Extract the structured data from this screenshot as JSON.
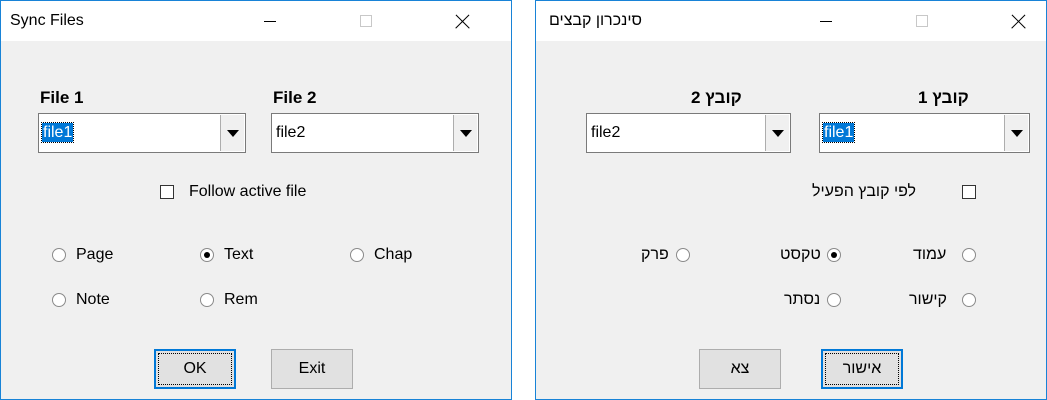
{
  "en": {
    "title": "Sync Files",
    "file1_label": "File 1",
    "file2_label": "File 2",
    "file1_value": "file1",
    "file2_value": "file2",
    "follow_label": "Follow active file",
    "follow_checked": false,
    "radios": {
      "page": "Page",
      "text": "Text",
      "chap": "Chap",
      "note": "Note",
      "rem": "Rem"
    },
    "selected_radio": "Text",
    "ok_label": "OK",
    "exit_label": "Exit"
  },
  "he": {
    "title": "סינכרון קבצים",
    "file1_label": "קובץ 1",
    "file2_label": "קובץ 2",
    "file1_value": "file1",
    "file2_value": "file2",
    "follow_label": "לפי קובץ הפעיל",
    "follow_checked": false,
    "radios": {
      "page": "עמוד",
      "text": "טקסט",
      "chap": "פרק",
      "link": "קישור",
      "hidden": "נסתר"
    },
    "selected_radio": "טקסט",
    "ok_label": "אישור",
    "exit_label": "צא"
  }
}
